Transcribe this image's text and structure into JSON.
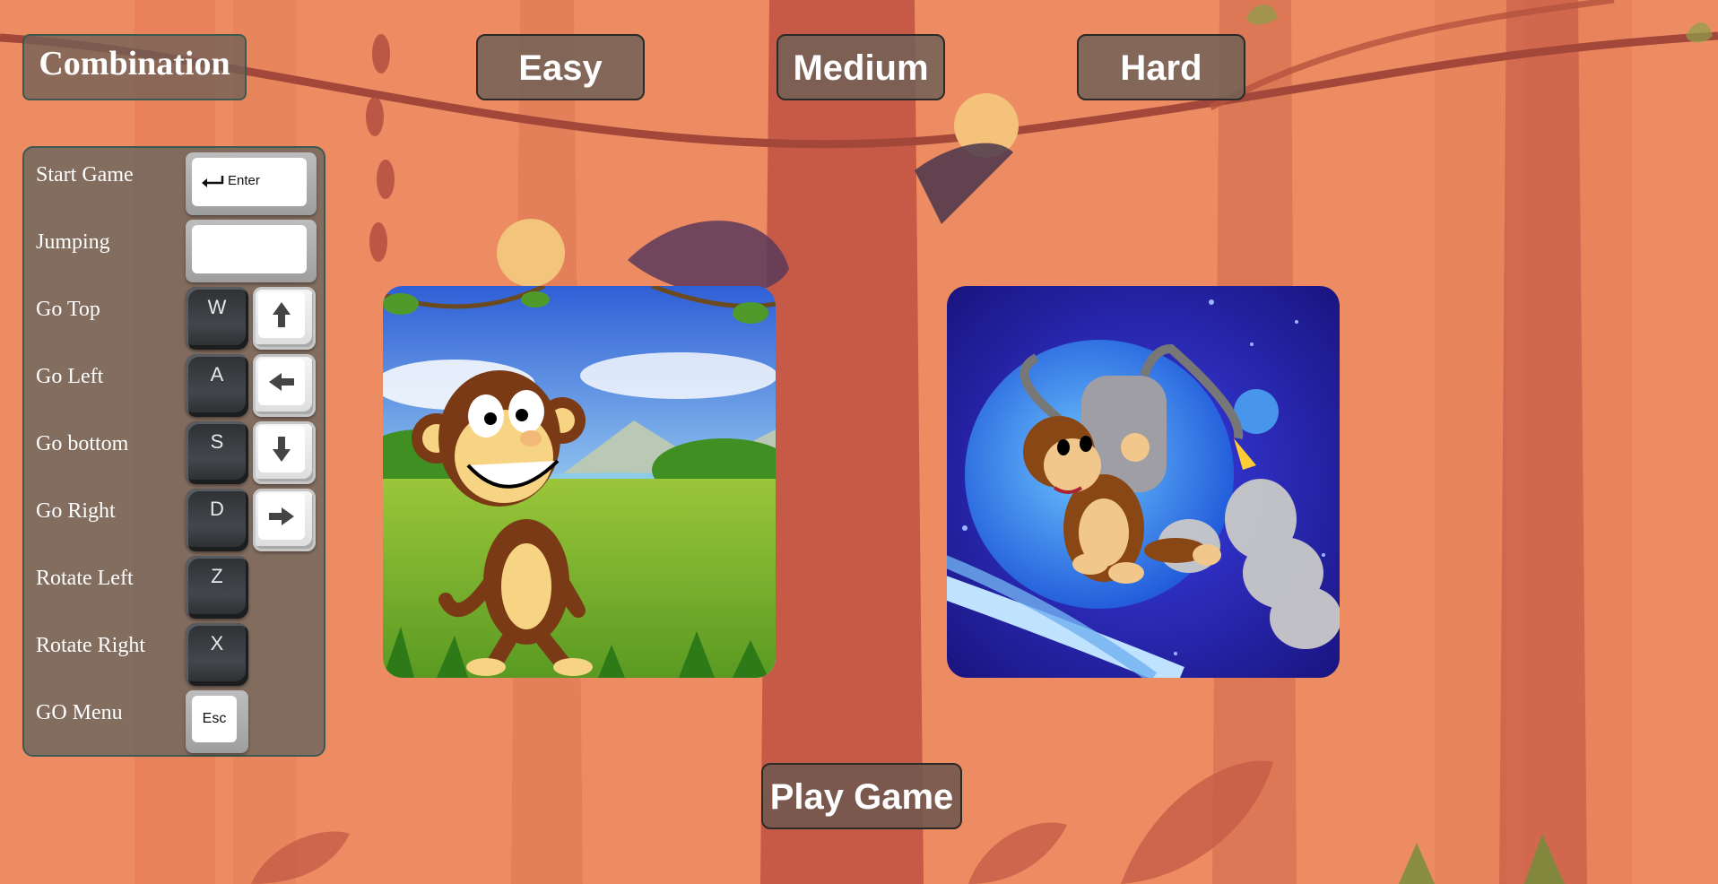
{
  "combination": {
    "title": "Combination"
  },
  "difficulty": {
    "easy_label": "Easy",
    "medium_label": "Medium",
    "hard_label": "Hard"
  },
  "controls": [
    {
      "action": "Start Game",
      "keys": [
        {
          "type": "wide",
          "label": "Enter",
          "icon": "enter-arrow-icon"
        }
      ]
    },
    {
      "action": "Jumping",
      "keys": [
        {
          "type": "wide",
          "label": "",
          "icon": "spacebar"
        }
      ]
    },
    {
      "action": "Go Top",
      "keys": [
        {
          "type": "dark",
          "label": "W"
        },
        {
          "type": "light",
          "icon": "arrow-up-icon"
        }
      ]
    },
    {
      "action": "Go Left",
      "keys": [
        {
          "type": "dark",
          "label": "A"
        },
        {
          "type": "light",
          "icon": "arrow-left-icon"
        }
      ]
    },
    {
      "action": "Go bottom",
      "keys": [
        {
          "type": "dark",
          "label": "S"
        },
        {
          "type": "light",
          "icon": "arrow-down-icon"
        }
      ]
    },
    {
      "action": "Go Right",
      "keys": [
        {
          "type": "dark",
          "label": "D"
        },
        {
          "type": "light",
          "icon": "arrow-right-icon"
        }
      ]
    },
    {
      "action": "Rotate Left",
      "keys": [
        {
          "type": "dark",
          "label": "Z"
        }
      ]
    },
    {
      "action": "Rotate Right",
      "keys": [
        {
          "type": "dark",
          "label": "X"
        }
      ]
    },
    {
      "action": "GO Menu",
      "keys": [
        {
          "type": "esc",
          "label": "Esc"
        }
      ]
    }
  ],
  "modes": [
    {
      "name": "jungle-monkey",
      "icon": "cartoon-monkey-icon"
    },
    {
      "name": "space-monkey",
      "icon": "jetpack-monkey-icon"
    }
  ],
  "play": {
    "label": "Play Game"
  },
  "colors": {
    "background": "#ec8a62",
    "panel": "#706a5e",
    "button": "#706056"
  }
}
